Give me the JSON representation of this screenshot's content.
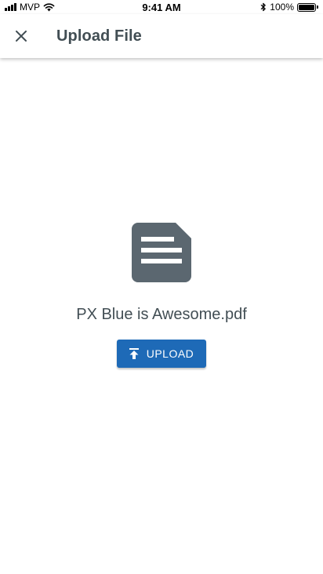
{
  "status_bar": {
    "carrier": "MVP",
    "time": "9:41 AM",
    "battery": "100%",
    "icons": [
      "signal-icon",
      "wifi-icon",
      "bluetooth-icon",
      "battery-icon"
    ]
  },
  "app_bar": {
    "title": "Upload File",
    "close_icon": "close-icon"
  },
  "content": {
    "file_icon": "document-icon",
    "file_name": "PX Blue is Awesome.pdf",
    "upload_button": {
      "label": "UPLOAD",
      "icon": "upload-icon"
    }
  },
  "colors": {
    "primary": "#1e6ab7",
    "text": "#424e54",
    "icon_gray": "#5b6770"
  }
}
